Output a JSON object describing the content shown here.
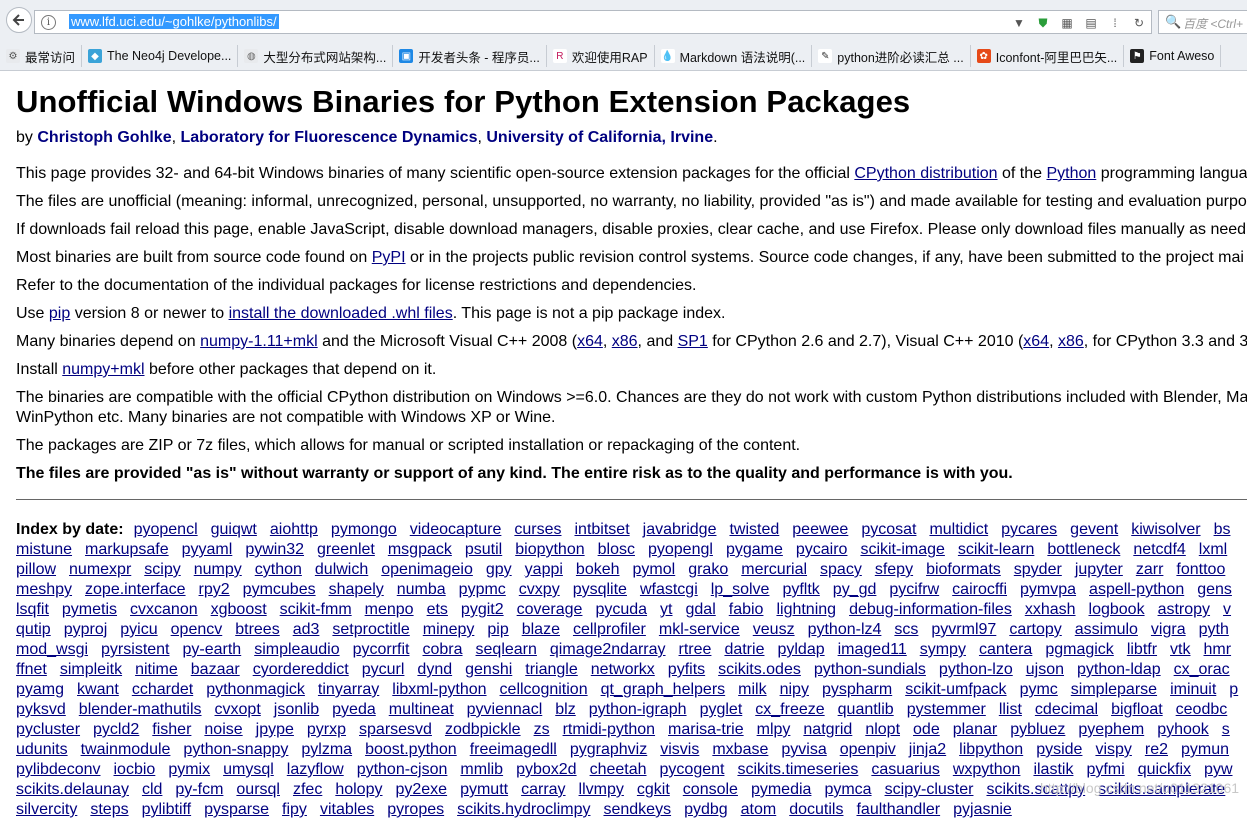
{
  "browser": {
    "url": "www.lfd.uci.edu/~gohlke/pythonlibs/",
    "search_placeholder": "百度 <Ctrl+",
    "bookmarks": [
      {
        "label": "最常访问",
        "icon": "gear-icon"
      },
      {
        "label": "The Neo4j Develope...",
        "icon": "neo4j-icon"
      },
      {
        "label": "大型分布式网站架构...",
        "icon": "globe-icon"
      },
      {
        "label": "开发者头条 - 程序员...",
        "icon": "toutiao-icon"
      },
      {
        "label": "欢迎使用RAP",
        "icon": "rap-icon"
      },
      {
        "label": "Markdown 语法说明(...",
        "icon": "drop-icon"
      },
      {
        "label": "python进阶必读汇总 ...",
        "icon": "leaf-icon"
      },
      {
        "label": "Iconfont-阿里巴巴矢...",
        "icon": "iconfont-icon"
      },
      {
        "label": "Font Aweso",
        "icon": "flag-icon"
      }
    ]
  },
  "page": {
    "title": "Unofficial Windows Binaries for Python Extension Packages",
    "by": "by",
    "authors": [
      "Christoph Gohlke",
      "Laboratory for Fluorescence Dynamics",
      "University of California, Irvine"
    ],
    "sep": ", ",
    "period": ".",
    "p1": {
      "a": "This page provides 32- and 64-bit Windows binaries of many scientific open-source extension packages for the official ",
      "l1": "CPython distribution",
      "b": " of the ",
      "l2": "Python",
      "c": " programming langua"
    },
    "p2": "The files are unofficial (meaning: informal, unrecognized, personal, unsupported, no warranty, no liability, provided \"as is\") and made available for testing and evaluation purpo",
    "p3": "If downloads fail reload this page, enable JavaScript, disable download managers, disable proxies, clear cache, and use Firefox. Please only download files manually as need",
    "p4": {
      "a": "Most binaries are built from source code found on ",
      "l1": "PyPI",
      "b": " or in the projects public revision control systems. Source code changes, if any, have been submitted to the project mai"
    },
    "p5": "Refer to the documentation of the individual packages for license restrictions and dependencies.",
    "p6": {
      "a": "Use ",
      "l1": "pip",
      "b": " version 8 or newer to ",
      "l2": "install the downloaded .whl files",
      "c": ". This page is not a pip package index."
    },
    "p7": {
      "a": "Many binaries depend on ",
      "l1": "numpy-1.11+mkl",
      "b": " and the Microsoft Visual C++ 2008 (",
      "l2": "x64",
      "c": ", ",
      "l3": "x86",
      "d": ", and ",
      "l4": "SP1",
      "e": " for CPython 2.6 and 2.7), Visual C++ 2010 (",
      "l5": "x64",
      "f": ", ",
      "l6": "x86",
      "g": ", for CPython 3.3 and 3"
    },
    "p8": {
      "a": "Install ",
      "l1": "numpy+mkl",
      "b": " before other packages that depend on it."
    },
    "p9a": "The binaries are compatible with the official CPython distribution on Windows >=6.0. Chances are they do not work with custom Python distributions included with Blender, Ma",
    "p9b": "WinPython etc. Many binaries are not compatible with Windows XP or Wine.",
    "p10": "The packages are ZIP or 7z files, which allows for manual or scripted installation or repackaging of the content.",
    "p11": "The files are provided \"as is\" without warranty or support of any kind. The entire risk as to the quality and performance is with you.",
    "index_label": "Index by date:",
    "index_rows": [
      [
        "pyopencl",
        "guiqwt",
        "aiohttp",
        "pymongo",
        "videocapture",
        "curses",
        "intbitset",
        "javabridge",
        "twisted",
        "peewee",
        "pycosat",
        "multidict",
        "pycares",
        "gevent",
        "kiwisolver",
        "bs"
      ],
      [
        "mistune",
        "markupsafe",
        "pyyaml",
        "pywin32",
        "greenlet",
        "msgpack",
        "psutil",
        "biopython",
        "blosc",
        "pyopengl",
        "pygame",
        "pycairo",
        "scikit-image",
        "scikit-learn",
        "bottleneck",
        "netcdf4",
        "lxml"
      ],
      [
        "pillow",
        "numexpr",
        "scipy",
        "numpy",
        "cython",
        "dulwich",
        "openimageio",
        "gpy",
        "yappi",
        "bokeh",
        "pymol",
        "grako",
        "mercurial",
        "spacy",
        "sfepy",
        "bioformats",
        "spyder",
        "jupyter",
        "zarr",
        "fonttoo"
      ],
      [
        "meshpy",
        "zope.interface",
        "rpy2",
        "pymcubes",
        "shapely",
        "numba",
        "pypmc",
        "cvxpy",
        "pysqlite",
        "wfastcgi",
        "lp_solve",
        "pyfltk",
        "py_gd",
        "pycifrw",
        "cairocffi",
        "pymvpa",
        "aspell-python",
        "gens"
      ],
      [
        "lsqfit",
        "pymetis",
        "cvxcanon",
        "xgboost",
        "scikit-fmm",
        "menpo",
        "ets",
        "pygit2",
        "coverage",
        "pycuda",
        "yt",
        "gdal",
        "fabio",
        "lightning",
        "debug-information-files",
        "xxhash",
        "logbook",
        "astropy",
        "v"
      ],
      [
        "qutip",
        "pyproj",
        "pyicu",
        "opencv",
        "btrees",
        "ad3",
        "setproctitle",
        "minepy",
        "pip",
        "blaze",
        "cellprofiler",
        "mkl-service",
        "veusz",
        "python-lz4",
        "scs",
        "pyvrml97",
        "cartopy",
        "assimulo",
        "vigra",
        "pyth"
      ],
      [
        "mod_wsgi",
        "pyrsistent",
        "py-earth",
        "simpleaudio",
        "pycorrfit",
        "cobra",
        "seqlearn",
        "qimage2ndarray",
        "rtree",
        "datrie",
        "pyldap",
        "imaged11",
        "sympy",
        "cantera",
        "pgmagick",
        "libtfr",
        "vtk",
        "hmr"
      ],
      [
        "ffnet",
        "simpleitk",
        "nitime",
        "bazaar",
        "cyordereddict",
        "pycurl",
        "dynd",
        "genshi",
        "triangle",
        "networkx",
        "pyfits",
        "scikits.odes",
        "python-sundials",
        "python-lzo",
        "ujson",
        "python-ldap",
        "cx_orac"
      ],
      [
        "pyamg",
        "kwant",
        "cchardet",
        "pythonmagick",
        "tinyarray",
        "libxml-python",
        "cellcognition",
        "qt_graph_helpers",
        "milk",
        "nipy",
        "pyspharm",
        "scikit-umfpack",
        "pymc",
        "simpleparse",
        "iminuit",
        "p"
      ],
      [
        "pyksvd",
        "blender-mathutils",
        "cvxopt",
        "jsonlib",
        "pyeda",
        "multineat",
        "pyviennacl",
        "blz",
        "python-igraph",
        "pyglet",
        "cx_freeze",
        "quantlib",
        "pystemmer",
        "llist",
        "cdecimal",
        "bigfloat",
        "ceodbc"
      ],
      [
        "pycluster",
        "pycld2",
        "fisher",
        "noise",
        "jpype",
        "pyrxp",
        "sparsesvd",
        "zodbpickle",
        "zs",
        "rtmidi-python",
        "marisa-trie",
        "mlpy",
        "natgrid",
        "nlopt",
        "ode",
        "planar",
        "pybluez",
        "pyephem",
        "pyhook",
        "s"
      ],
      [
        "udunits",
        "twainmodule",
        "python-snappy",
        "pylzma",
        "boost.python",
        "freeimagedll",
        "pygraphviz",
        "visvis",
        "mxbase",
        "pyvisa",
        "openpiv",
        "jinja2",
        "libpython",
        "pyside",
        "vispy",
        "re2",
        "pymun"
      ],
      [
        "pylibdeconv",
        "iocbio",
        "pymix",
        "umysql",
        "lazyflow",
        "python-cjson",
        "mmlib",
        "pybox2d",
        "cheetah",
        "pycogent",
        "scikits.timeseries",
        "casuarius",
        "wxpython",
        "ilastik",
        "pyfmi",
        "quickfix",
        "pyw"
      ],
      [
        "scikits.delaunay",
        "cld",
        "py-fcm",
        "oursql",
        "zfec",
        "holopy",
        "py2exe",
        "pymutt",
        "carray",
        "llvmpy",
        "cgkit",
        "console",
        "pymedia",
        "pymca",
        "scipy-cluster",
        "scikits.scattpy",
        "scikits.samplerate"
      ],
      [
        "silvercity",
        "steps",
        "pylibtiff",
        "pysparse",
        "fipy",
        "vitables",
        "pyropes",
        "scikits.hydroclimpy",
        "sendkeys",
        "pydbg",
        "atom",
        "docutils",
        "faulthandler",
        "pyjasnie"
      ]
    ],
    "watermark": "http://blog.csdn.net/u011321061"
  }
}
